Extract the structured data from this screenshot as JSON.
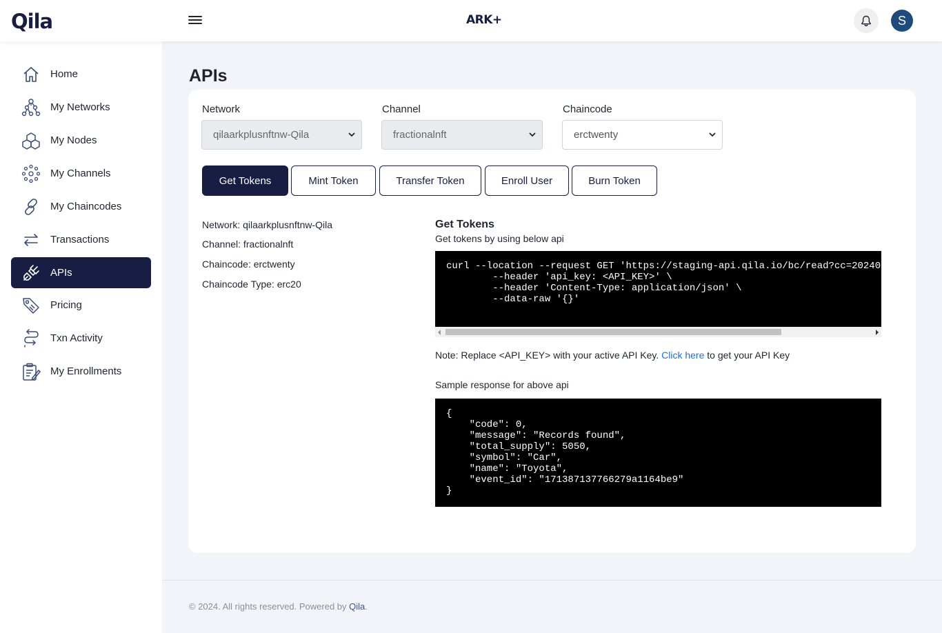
{
  "header": {
    "logo_text": "Qila",
    "brand_text": "ARK+",
    "avatar_initial": "S",
    "menu_icon": "hamburger-icon",
    "bell_icon": "bell-icon"
  },
  "sidebar": {
    "items": [
      {
        "label": "Home",
        "icon": "home-icon"
      },
      {
        "label": "My Networks",
        "icon": "network-icon"
      },
      {
        "label": "My Nodes",
        "icon": "nodes-icon"
      },
      {
        "label": "My Channels",
        "icon": "channels-icon"
      },
      {
        "label": "My Chaincodes",
        "icon": "link-icon"
      },
      {
        "label": "Transactions",
        "icon": "arrows-icon"
      },
      {
        "label": "APIs",
        "icon": "plug-icon",
        "active": true
      },
      {
        "label": "Pricing",
        "icon": "tag-icon"
      },
      {
        "label": "Txn Activity",
        "icon": "route-icon"
      },
      {
        "label": "My Enrollments",
        "icon": "clipboard-icon"
      }
    ]
  },
  "main": {
    "title": "APIs",
    "filters": {
      "network": {
        "label": "Network",
        "value": "qilaarkplusnftnw-Qila"
      },
      "channel": {
        "label": "Channel",
        "value": "fractionalnft"
      },
      "chaincode": {
        "label": "Chaincode",
        "value": "erctwenty"
      }
    },
    "tabs": [
      "Get Tokens",
      "Mint Token",
      "Transfer Token",
      "Enroll User",
      "Burn Token"
    ],
    "active_tab": "Get Tokens",
    "info": {
      "network": "Network: qilaarkplusnftnw-Qila",
      "channel": "Channel: fractionalnft",
      "chaincode": "Chaincode: erctwenty",
      "type": "Chaincode Type: erc20"
    },
    "section_title": "Get Tokens",
    "section_subtitle": "Get tokens by using below api",
    "request_code": "curl --location --request GET 'https://staging-api.qila.io/bc/read?cc=20240\n        --header 'api_key: <API_KEY>' \\\n        --header 'Content-Type: application/json' \\\n        --data-raw '{}'",
    "note_prefix": "Note: Replace <API_KEY> with your active API Key.",
    "note_link": "Click here",
    "note_suffix": "to get your API Key",
    "sample_label": "Sample response for above api",
    "response_code": "{\n    \"code\": 0,\n    \"message\": \"Records found\",\n    \"total_supply\": 5050,\n    \"symbol\": \"Car\",\n    \"name\": \"Toyota\",\n    \"event_id\": \"171387137766279a1164be9\"\n}"
  },
  "footer": {
    "text": "© 2024. All rights reserved. Powered by",
    "link": "Qila"
  },
  "colors": {
    "brand": "#181d44",
    "link": "#1f6fde",
    "background": "#f3f4fa"
  }
}
